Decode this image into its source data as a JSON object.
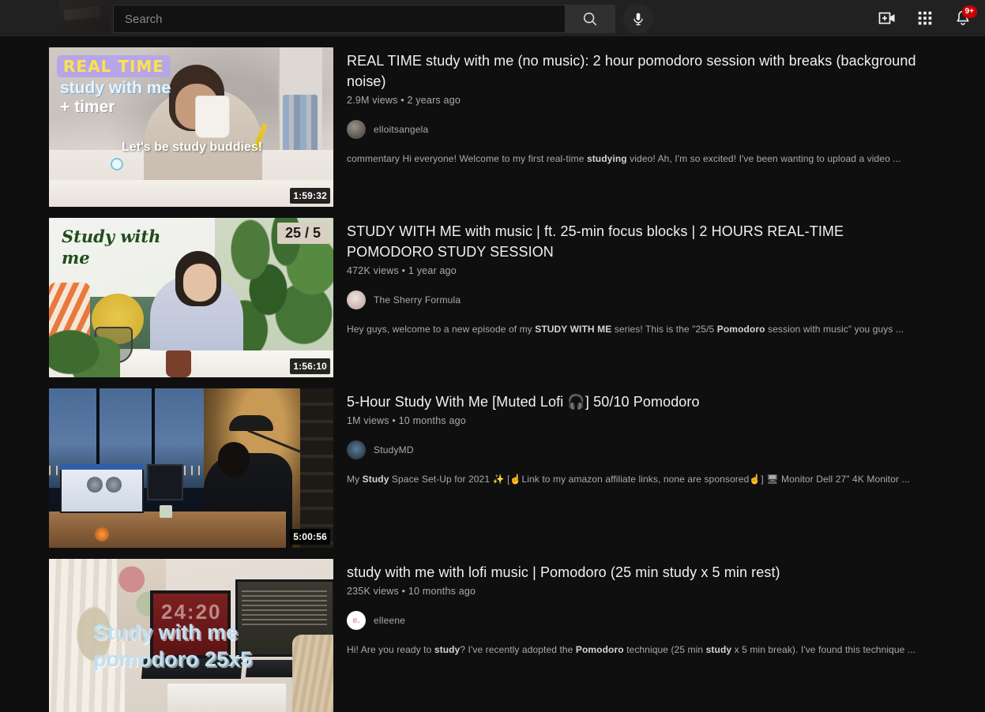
{
  "header": {
    "search": {
      "value": "",
      "placeholder": "Search"
    },
    "search_button_label": "search-icon",
    "mic_button_label": "voice-search-icon",
    "notifications_badge": "9+",
    "icons": {
      "create": "create-video-icon",
      "apps": "youtube-apps-grid-icon",
      "notifications": "notifications-bell-icon"
    }
  },
  "results": [
    {
      "title": "REAL TIME study with me (no music): 2 hour pomodoro session with breaks (background noise)",
      "views": "2.9M views",
      "age": "2 years ago",
      "separator": "•",
      "channel": "elloitsangela",
      "duration": "1:59:32",
      "description_parts": [
        {
          "text": "commentary Hi everyone! Welcome to my first real-time ",
          "bold": false
        },
        {
          "text": "studying",
          "bold": true
        },
        {
          "text": " video! Ah, I'm so excited! I've been wanting to upload a video ...",
          "bold": false
        }
      ],
      "thumbnail_text": {
        "badge": "REAL TIME",
        "line2": "study with me",
        "line3": "+ timer",
        "line4": "Let's be study buddies!"
      }
    },
    {
      "title": "STUDY WITH ME with music | ft. 25-min focus blocks | 2 HOURS REAL-TIME POMODORO STUDY SESSION",
      "views": "472K views",
      "age": "1 year ago",
      "separator": "•",
      "channel": "The Sherry Formula",
      "duration": "1:56:10",
      "description_parts": [
        {
          "text": "Hey guys, welcome to a new episode of my ",
          "bold": false
        },
        {
          "text": "STUDY WITH ME",
          "bold": true
        },
        {
          "text": " series! This is the \"25/5 ",
          "bold": false
        },
        {
          "text": "Pomodoro",
          "bold": true
        },
        {
          "text": " session with music\" you guys ...",
          "bold": false
        }
      ],
      "thumbnail_text": {
        "script": "Study with me",
        "ratio": "25 / 5"
      }
    },
    {
      "title": "5-Hour Study With Me [Muted Lofi 🎧] 50/10 Pomodoro",
      "views": "1M views",
      "age": "10 months ago",
      "separator": "•",
      "channel": "StudyMD",
      "duration": "5:00:56",
      "description_parts": [
        {
          "text": "My ",
          "bold": false
        },
        {
          "text": "Study",
          "bold": true
        },
        {
          "text": " Space Set-Up for 2021 ✨ [☝Link to my amazon affiliate links, none are sponsored☝] 🖥 Monitor Dell 27\" 4K Monitor ...",
          "bold": false
        }
      ],
      "thumbnail_text": {}
    },
    {
      "title": "study with me with lofi music | Pomodoro (25 min study x 5 min rest)",
      "views": "235K views",
      "age": "10 months ago",
      "separator": "•",
      "channel": "elleene",
      "duration": "",
      "description_parts": [
        {
          "text": "Hi! Are you ready to ",
          "bold": false
        },
        {
          "text": "study",
          "bold": true
        },
        {
          "text": "? I've recently adopted the ",
          "bold": false
        },
        {
          "text": "Pomodoro",
          "bold": true
        },
        {
          "text": " technique (25 min ",
          "bold": false
        },
        {
          "text": "study",
          "bold": true
        },
        {
          "text": " x 5 min break). I've found this technique ...",
          "bold": false
        }
      ],
      "thumbnail_text": {
        "timer": "24:20",
        "lineA": "Study with me",
        "lineB": "pomodoro 25x5"
      },
      "avatar_initial": "e."
    }
  ],
  "colors": {
    "background": "#0f0f0f",
    "header": "#212121",
    "badge_red": "#cc0000",
    "text_primary": "#f1f1f1",
    "text_secondary": "#aaaaaa"
  }
}
